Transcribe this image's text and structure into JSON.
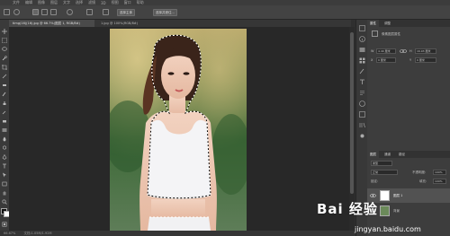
{
  "menubar": {
    "items": [
      "PS",
      "文件",
      "编辑",
      "图像",
      "图层",
      "文字",
      "选择",
      "滤镜",
      "3D",
      "视图",
      "窗口",
      "帮助"
    ]
  },
  "optionsbar": {
    "select_subject_label": "选择主体",
    "select_and_mask_label": "选择并遮住..."
  },
  "document": {
    "tab_active": "timg(16)(16).jpg @ 66.7%(图层 1, RGB/8#)",
    "tab_inactive": "1.jpg @ 100%(RGB/8#)"
  },
  "status": {
    "zoom": "66.67%",
    "doc_info": "文档:1.05M/1.92M"
  },
  "properties": {
    "tab_label": "属性",
    "tab2_label": "调整",
    "section_title": "像素图层属性",
    "w_label": "W",
    "w_value": "4.40 厘米",
    "h_label": "H",
    "h_value": "16.93 厘米",
    "x_label": "X",
    "x_value": "0 厘米",
    "y_label": "Y",
    "y_value": "0 厘米"
  },
  "layers": {
    "tab_label": "图层",
    "tab2_label": "通道",
    "tab3_label": "路径",
    "kind_label": "类型",
    "blend_mode": "正常",
    "opacity_label": "不透明度:",
    "opacity_value": "100%",
    "lock_label": "锁定:",
    "fill_label": "填充:",
    "fill_value": "100%",
    "items": [
      {
        "name": "图层 1"
      },
      {
        "name": "背景"
      }
    ]
  },
  "watermark": {
    "text": "Bai 经验",
    "url": "jingyan.baidu.com"
  },
  "colors": {
    "ui_dark": "#2f2f2f",
    "panel": "#3d3d3d",
    "accent": "#5f87c5"
  }
}
